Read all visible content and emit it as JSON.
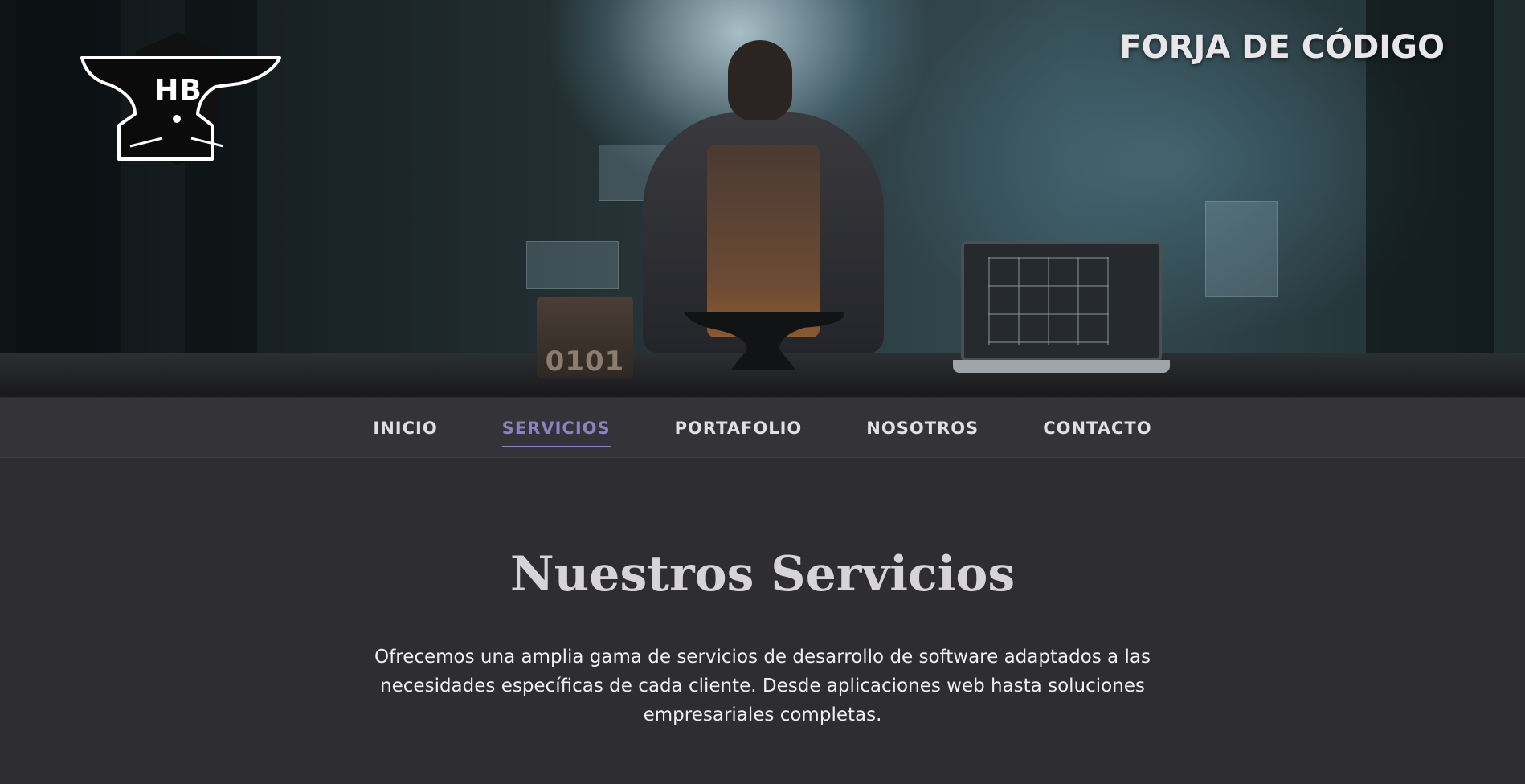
{
  "header": {
    "brand": "FORJA DE CÓDIGO",
    "logo_text": "HB",
    "hero_block_text": "0101"
  },
  "nav": {
    "items": [
      {
        "label": "INICIO",
        "active": false
      },
      {
        "label": "SERVICIOS",
        "active": true
      },
      {
        "label": "PORTAFOLIO",
        "active": false
      },
      {
        "label": "NOSOTROS",
        "active": false
      },
      {
        "label": "CONTACTO",
        "active": false
      }
    ]
  },
  "services": {
    "title": "Nuestros Servicios",
    "description": "Ofrecemos una amplia gama de servicios de desarrollo de software adaptados a las necesidades específicas de cada cliente. Desde aplicaciones web hasta soluciones empresariales completas."
  },
  "colors": {
    "background": "#2e2d32",
    "nav_background": "#343338",
    "nav_active": "#8b82c2",
    "text": "#efeef2"
  }
}
